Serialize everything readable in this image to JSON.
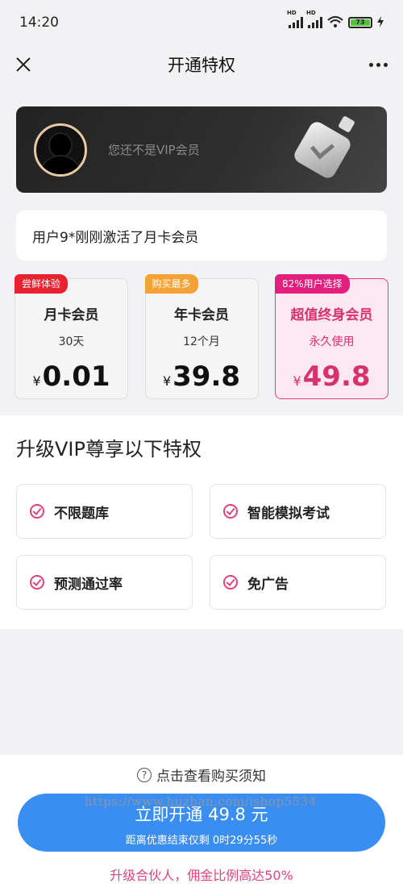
{
  "status": {
    "time": "14:20",
    "battery": "73"
  },
  "nav": {
    "title": "开通特权"
  },
  "vip": {
    "status_text": "您还不是VIP会员"
  },
  "ticker": {
    "text": "用户9*刚刚激活了月卡会员"
  },
  "plans": [
    {
      "tag": "尝鲜体验",
      "name": "月卡会员",
      "duration": "30天",
      "currency": "¥",
      "price": "0.01"
    },
    {
      "tag": "购买最多",
      "name": "年卡会员",
      "duration": "12个月",
      "currency": "¥",
      "price": "39.8"
    },
    {
      "tag": "82%用户选择",
      "name": "超值终身会员",
      "duration": "永久使用",
      "currency": "¥",
      "price": "49.8"
    }
  ],
  "privileges": {
    "title": "升级VIP尊享以下特权",
    "items": [
      "不限题库",
      "智能模拟考试",
      "预测通过率",
      "免广告"
    ]
  },
  "footer": {
    "notice": "点击查看购买须知",
    "buy_label": "立即开通 49.8 元",
    "countdown": "距离优惠结束仅剩 0时29分55秒",
    "watermark": "https://www.huzhan.com/ishop5534",
    "partner": "升级合伙人，佣金比例高达50%"
  },
  "colors": {
    "accent_pink": "#e0437f",
    "button_blue": "#3b8ef1",
    "tag_red": "#e8232f",
    "tag_orange": "#f5a135",
    "tag_pink": "#e41e7d"
  }
}
